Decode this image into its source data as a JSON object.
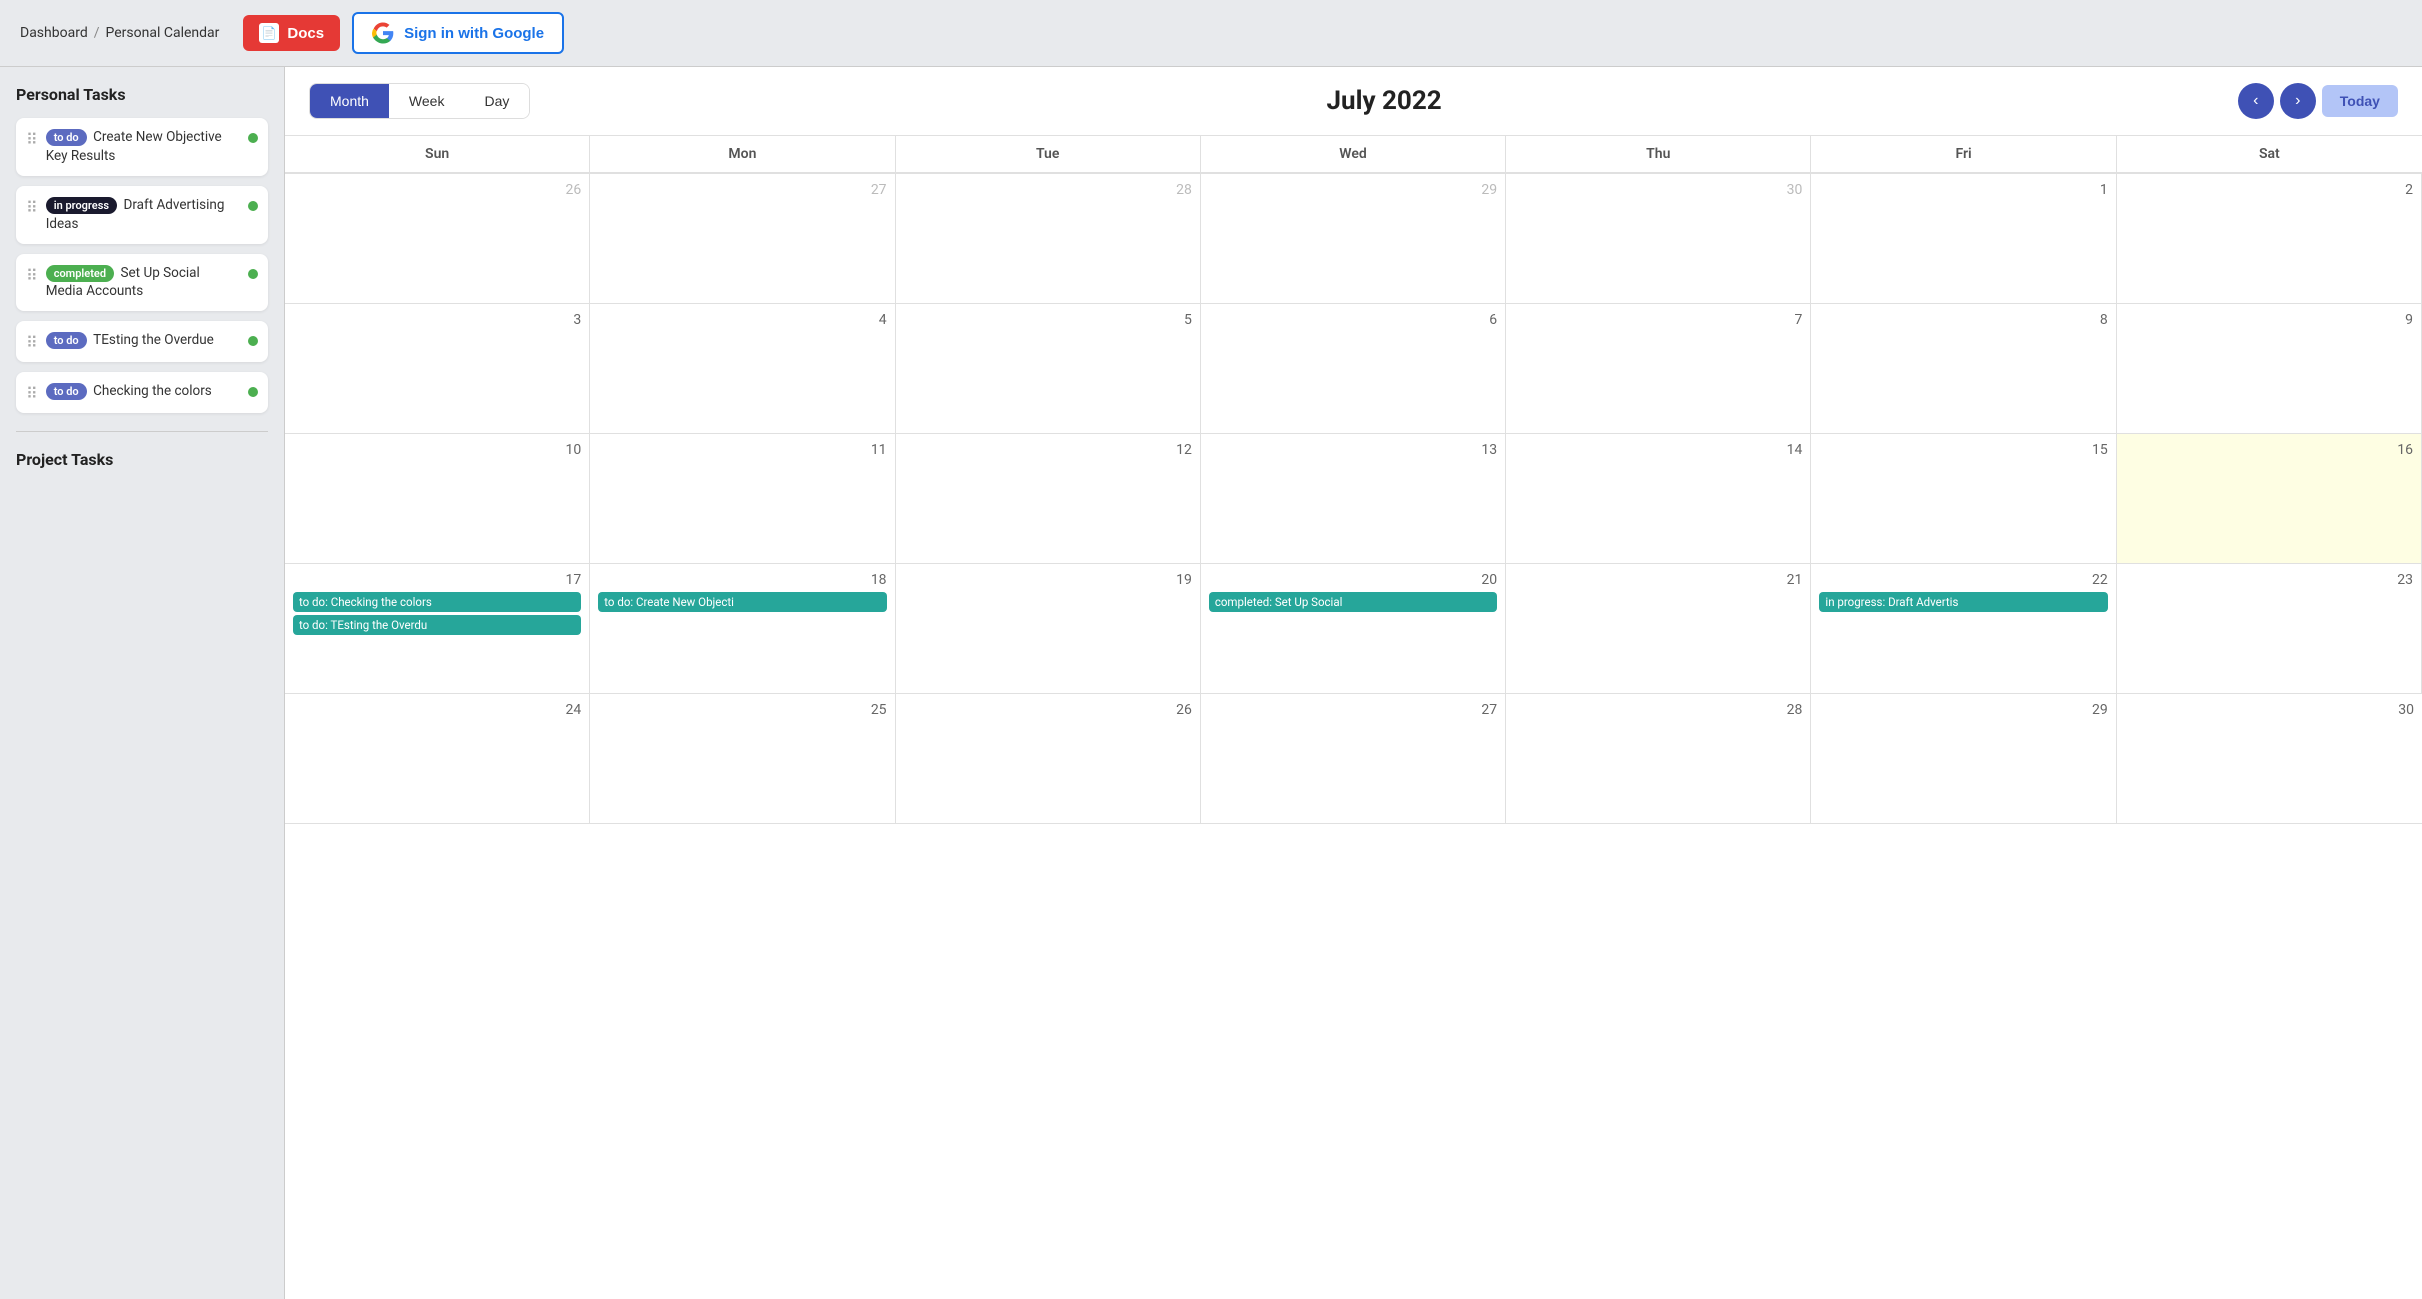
{
  "breadcrumb": {
    "items": [
      "Dashboard",
      "Personal Calendar"
    ],
    "sep": "/"
  },
  "topbar": {
    "docs_label": "Docs",
    "google_label": "Sign in with Google"
  },
  "sidebar": {
    "personal_tasks_title": "Personal Tasks",
    "project_tasks_title": "Project Tasks",
    "tasks": [
      {
        "id": "task1",
        "badge": "to do",
        "badge_type": "todo",
        "title": "Create New Objective Key Results"
      },
      {
        "id": "task2",
        "badge": "in progress",
        "badge_type": "inprogress",
        "title": "Draft Advertising Ideas"
      },
      {
        "id": "task3",
        "badge": "completed",
        "badge_type": "completed",
        "title": "Set Up Social Media Accounts"
      },
      {
        "id": "task4",
        "badge": "to do",
        "badge_type": "todo",
        "title": "TEsting the Overdue"
      },
      {
        "id": "task5",
        "badge": "to do",
        "badge_type": "todo",
        "title": "Checking the colors"
      }
    ]
  },
  "calendar": {
    "title": "July 2022",
    "view_buttons": [
      "Month",
      "Week",
      "Day"
    ],
    "active_view": "Month",
    "today_label": "Today",
    "days_of_week": [
      "Sun",
      "Mon",
      "Tue",
      "Wed",
      "Thu",
      "Fri",
      "Sat"
    ],
    "weeks": [
      [
        {
          "num": "26",
          "other": true,
          "events": []
        },
        {
          "num": "27",
          "other": true,
          "events": []
        },
        {
          "num": "28",
          "other": true,
          "events": []
        },
        {
          "num": "29",
          "other": true,
          "events": []
        },
        {
          "num": "30",
          "other": true,
          "events": []
        },
        {
          "num": "1",
          "other": false,
          "events": []
        },
        {
          "num": "2",
          "other": false,
          "events": []
        }
      ],
      [
        {
          "num": "3",
          "other": false,
          "events": []
        },
        {
          "num": "4",
          "other": false,
          "events": []
        },
        {
          "num": "5",
          "other": false,
          "events": []
        },
        {
          "num": "6",
          "other": false,
          "events": []
        },
        {
          "num": "7",
          "other": false,
          "events": []
        },
        {
          "num": "8",
          "other": false,
          "events": []
        },
        {
          "num": "9",
          "other": false,
          "events": []
        }
      ],
      [
        {
          "num": "10",
          "other": false,
          "events": []
        },
        {
          "num": "11",
          "other": false,
          "events": []
        },
        {
          "num": "12",
          "other": false,
          "events": []
        },
        {
          "num": "13",
          "other": false,
          "events": []
        },
        {
          "num": "14",
          "other": false,
          "events": []
        },
        {
          "num": "15",
          "other": false,
          "today": false,
          "events": []
        },
        {
          "num": "16",
          "other": false,
          "today": true,
          "events": []
        }
      ],
      [
        {
          "num": "17",
          "other": false,
          "events": [
            {
              "label": "to do: Checking the colors"
            },
            {
              "label": "to do: TEsting the Overdu"
            }
          ]
        },
        {
          "num": "18",
          "other": false,
          "events": [
            {
              "label": "to do: Create New Objecti"
            }
          ]
        },
        {
          "num": "19",
          "other": false,
          "events": []
        },
        {
          "num": "20",
          "other": false,
          "events": [
            {
              "label": "completed: Set Up Social"
            }
          ]
        },
        {
          "num": "21",
          "other": false,
          "events": []
        },
        {
          "num": "22",
          "other": false,
          "events": [
            {
              "label": "in progress: Draft Advertis"
            }
          ]
        },
        {
          "num": "23",
          "other": false,
          "events": []
        }
      ],
      [
        {
          "num": "24",
          "other": false,
          "events": []
        },
        {
          "num": "25",
          "other": false,
          "events": []
        },
        {
          "num": "26",
          "other": false,
          "events": []
        },
        {
          "num": "27",
          "other": false,
          "events": []
        },
        {
          "num": "28",
          "other": false,
          "events": []
        },
        {
          "num": "29",
          "other": false,
          "events": []
        },
        {
          "num": "30",
          "other": false,
          "events": []
        }
      ]
    ]
  }
}
